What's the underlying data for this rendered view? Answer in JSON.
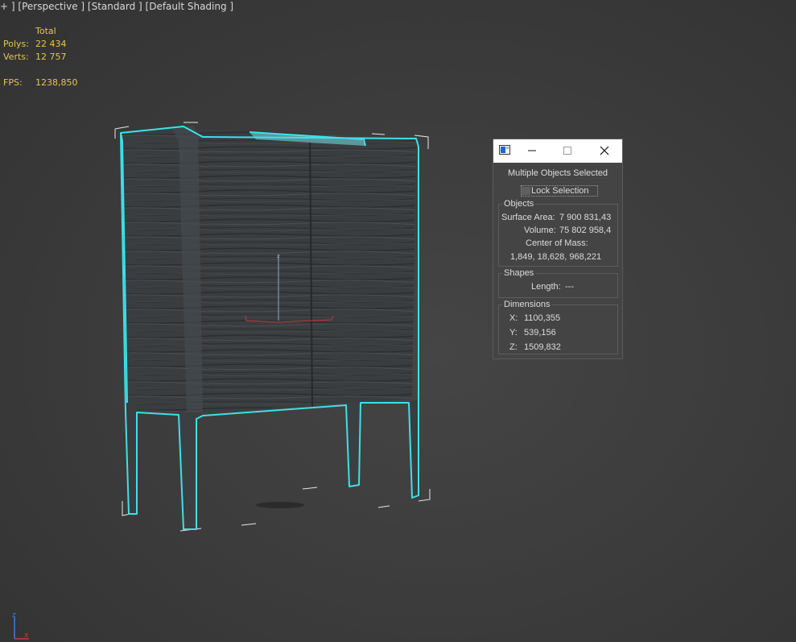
{
  "viewport": {
    "label_parts": [
      "+ ]",
      "[Perspective ]",
      "[Standard ]",
      "[Default Shading ]"
    ]
  },
  "stats": {
    "header": "Total",
    "polys_label": "Polys:",
    "polys_value": "22 434",
    "verts_label": "Verts:",
    "verts_value": "12 757",
    "fps_label": "FPS:",
    "fps_value": "1238,850"
  },
  "dialog": {
    "heading": "Multiple Objects Selected",
    "lock_selection_label": "Lock Selection",
    "objects_group": {
      "title": "Objects",
      "surface_area_label": "Surface Area:",
      "surface_area_value": "7 900 831,43",
      "volume_label": "Volume:",
      "volume_value": "75 802 958,4",
      "center_of_mass_label": "Center of Mass:",
      "center_of_mass_value": "1,849, 18,628, 968,221"
    },
    "shapes_group": {
      "title": "Shapes",
      "length_label": "Length:",
      "length_value": "---"
    },
    "dimensions_group": {
      "title": "Dimensions",
      "x_label": "X:",
      "x_value": "1100,355",
      "y_label": "Y:",
      "y_value": "539,156",
      "z_label": "Z:",
      "z_value": "1509,832"
    }
  },
  "icons": {
    "dialog_icon": "window-icon",
    "minimize": "minimize-icon",
    "maximize": "maximize-icon",
    "close": "close-icon",
    "gizmo": "transform-gizmo-icon",
    "axis_tripod": "axis-tripod-icon"
  },
  "colors": {
    "viewport_bg": "#3b3b3b",
    "stats_text": "#e6c64a",
    "selection_outline": "#3ee0e8",
    "wood": "#3a3d3f",
    "dialog_bg": "#444444"
  }
}
